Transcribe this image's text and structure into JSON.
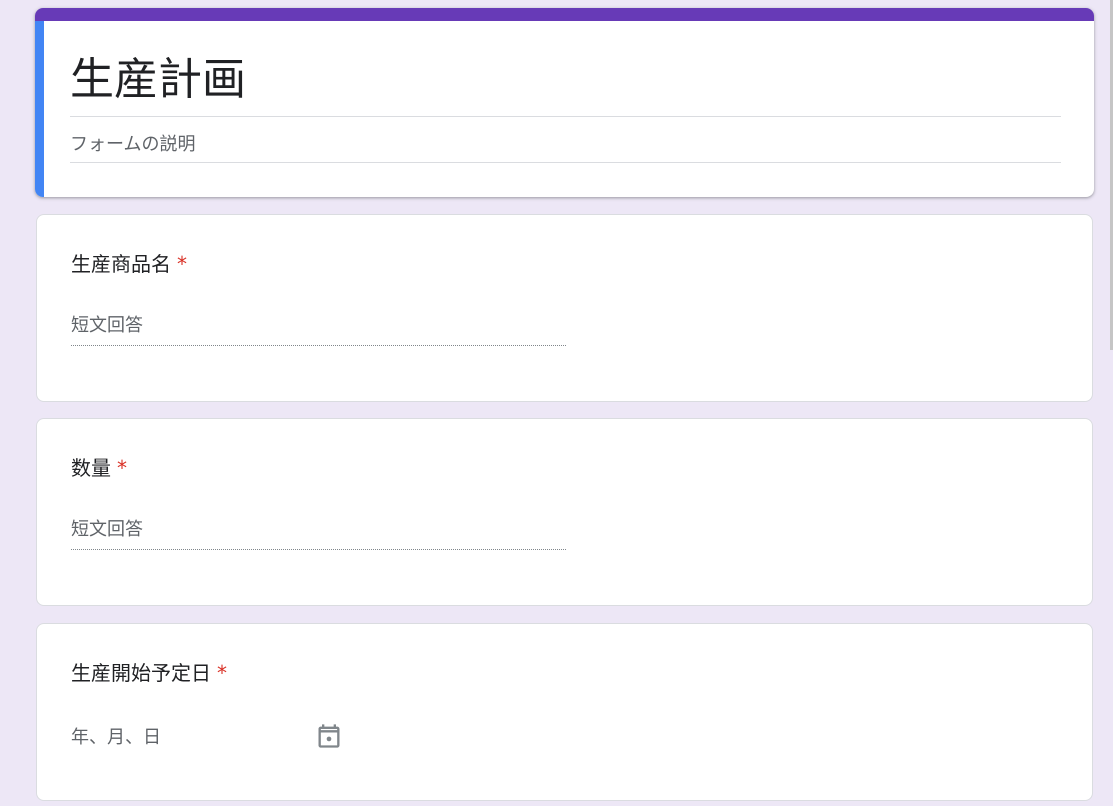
{
  "form": {
    "title": "生産計画",
    "description_placeholder": "フォームの説明"
  },
  "questions": [
    {
      "title": "生産商品名",
      "required_mark": "*",
      "answer_placeholder": "短文回答"
    },
    {
      "title": "数量",
      "required_mark": "*",
      "answer_placeholder": "短文回答"
    },
    {
      "title": "生産開始予定日",
      "required_mark": "*",
      "date_placeholder": "年、月、日",
      "icon": "calendar-icon"
    }
  ],
  "colors": {
    "background": "#ede7f6",
    "accent_top": "#673ab7",
    "accent_left": "#4285f4",
    "required": "#d93025"
  }
}
